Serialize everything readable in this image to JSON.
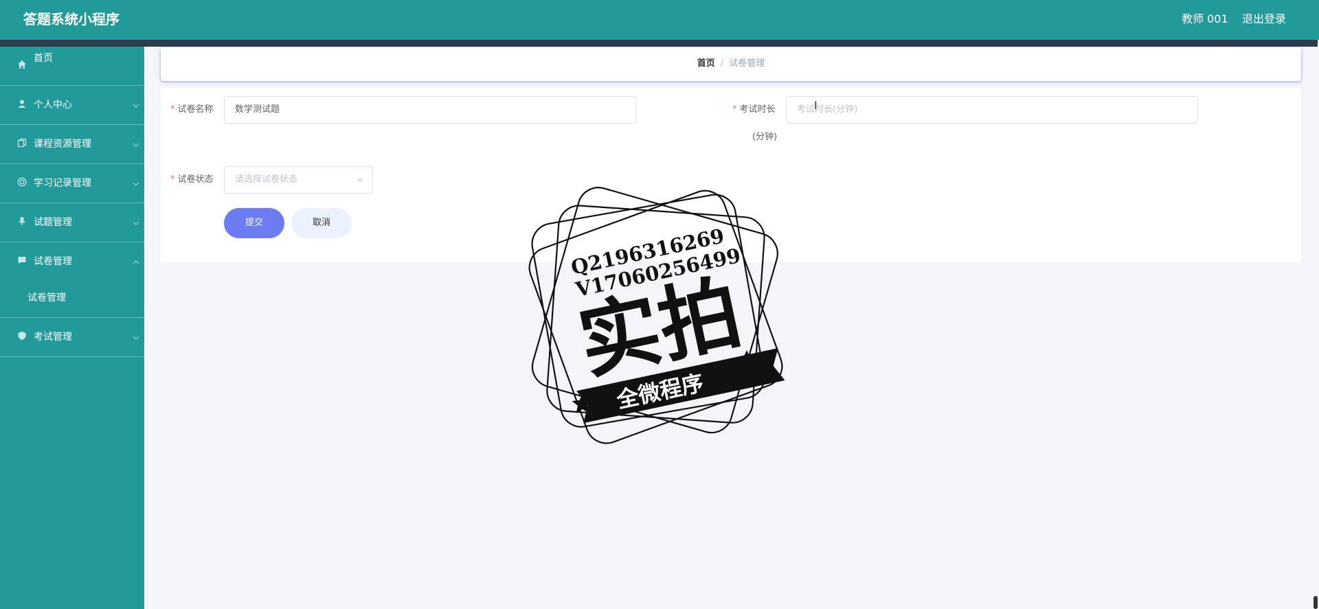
{
  "header": {
    "title": "答题系统小程序",
    "user": "教师 001",
    "logout": "退出登录"
  },
  "sidebar": {
    "items": [
      {
        "label": "首页",
        "icon": "home-icon"
      },
      {
        "label": "个人中心",
        "icon": "user-icon"
      },
      {
        "label": "课程资源管理",
        "icon": "copy-icon"
      },
      {
        "label": "学习记录管理",
        "icon": "target-icon"
      },
      {
        "label": "试题管理",
        "icon": "microphone-icon"
      },
      {
        "label": "试卷管理",
        "icon": "chat-icon"
      },
      {
        "label": "考试管理",
        "icon": "shield-icon"
      }
    ],
    "submenu": {
      "label": "试卷管理"
    }
  },
  "breadcrumb": {
    "home": "首页",
    "separator": "/",
    "current": "试卷管理"
  },
  "form": {
    "paper_name": {
      "label": "试卷名称",
      "value": "数学测试题"
    },
    "duration": {
      "label": "考试时长",
      "label_suffix": "(分钟)",
      "placeholder": "考试时长(分钟)"
    },
    "status": {
      "label": "试卷状态",
      "placeholder": "请选择试卷状态"
    },
    "submit": "提交",
    "cancel": "取消"
  },
  "watermark": {
    "line1": "Q2196316269",
    "line2": "V17060256499",
    "big": "实拍",
    "banner": "全微程序"
  },
  "colors": {
    "primary": "#229a9a",
    "stripe": "#2e3d4e",
    "submit": "#6b7cf5",
    "cancel_bg": "#ecf2fd",
    "required": "#f56c6c"
  }
}
